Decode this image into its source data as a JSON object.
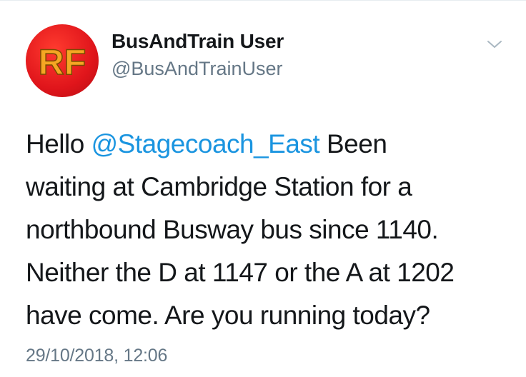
{
  "tweet": {
    "author": {
      "display_name": "BusAndTrain User",
      "handle": "@BusAndTrainUser",
      "avatar_text": "RF",
      "avatar_color": "#e0151b",
      "avatar_text_color": "#f5a623"
    },
    "menu_icon": "chevron-down-icon",
    "text": {
      "line1_prefix": "Hello ",
      "mention": "@Stagecoach_East",
      "line1_suffix": " Been",
      "line2": "waiting at Cambridge Station for a",
      "line3": "northbound Busway bus since 1140.",
      "line4": "Neither the D at 1147 or the A at 1202",
      "line5": "have come. Are you running today?"
    },
    "timestamp": "29/10/2018, 12:06",
    "colors": {
      "text": "#14171a",
      "secondary": "#657786",
      "link": "#1b95e0"
    }
  }
}
